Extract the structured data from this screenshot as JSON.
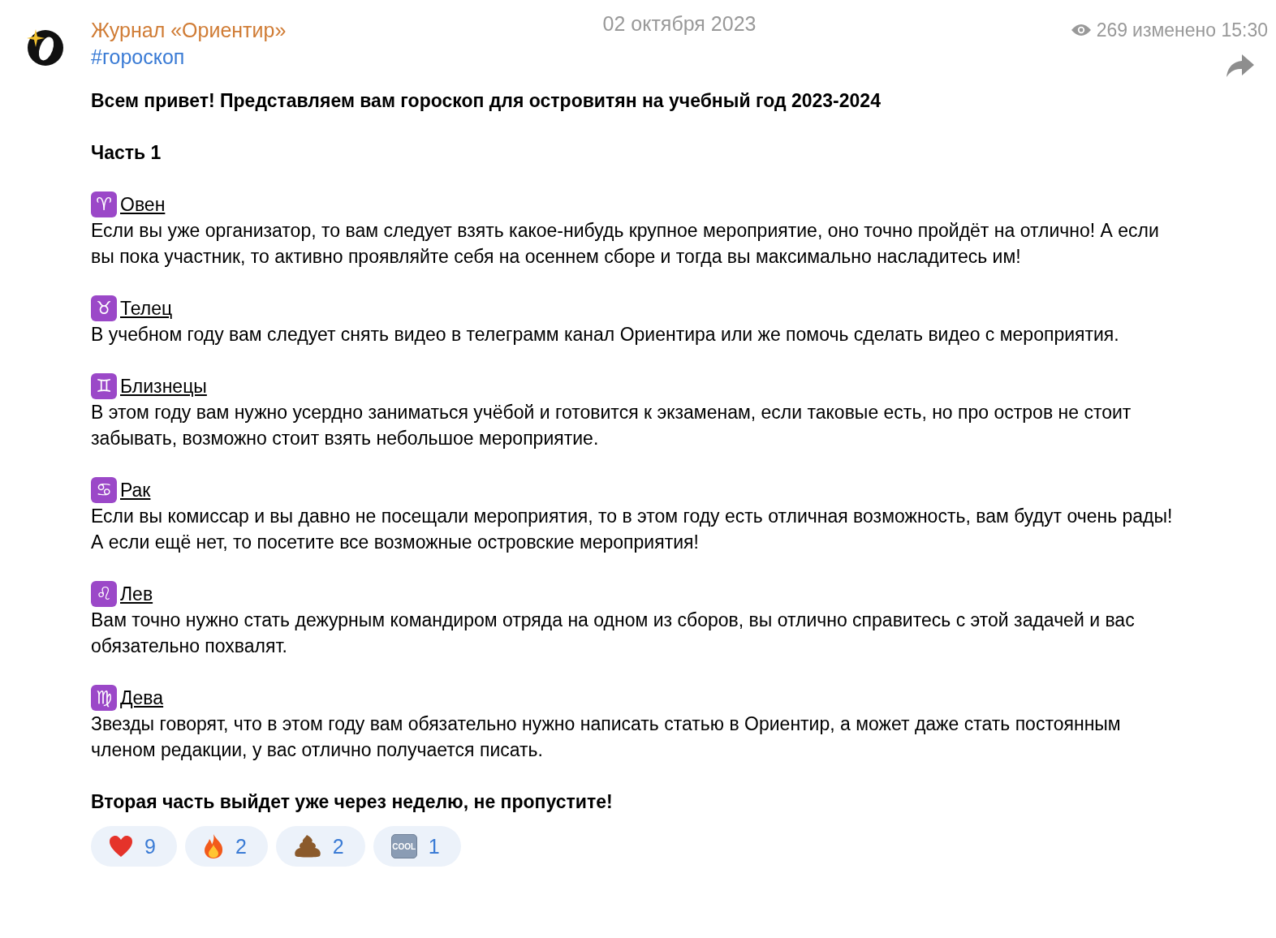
{
  "channel": {
    "name": "Журнал «Ориентир»",
    "hashtag": "#гороскоп"
  },
  "date": "02 октября 2023",
  "views": "269",
  "edited": "изменено 15:30",
  "post": {
    "intro": "Всем привет! Представляем вам гороскоп для островитян на учебный год 2023-2024",
    "part": "Часть 1",
    "signs": [
      {
        "symbol": "♈",
        "name": "Овен",
        "text": "Если вы уже организатор, то вам следует взять какое-нибудь крупное мероприятие, оно точно пройдёт на отлично! А если вы пока участник, то активно проявляйте себя на осеннем сборе и тогда вы максимально насладитесь им!"
      },
      {
        "symbol": "♉",
        "name": "Телец",
        "text": "В учебном году вам следует снять видео в телеграмм канал Ориентира или же помочь сделать видео с мероприятия."
      },
      {
        "symbol": "♊",
        "name": "Близнецы",
        "text": "В этом году вам нужно усердно заниматься учёбой и готовится к экзаменам, если таковые есть, но про остров не стоит забывать, возможно стоит взять небольшое мероприятие."
      },
      {
        "symbol": "♋",
        "name": "Рак",
        "text": "Если вы комиссар и вы давно не посещали мероприятия, то в этом году есть отличная возможность, вам будут очень рады! А если ещё нет, то посетите все возможные островские мероприятия!"
      },
      {
        "symbol": "♌",
        "name": "Лев",
        "text": "Вам точно нужно стать дежурным командиром отряда на одном из сборов, вы отлично справитесь с этой задачей и вас обязательно похвалят."
      },
      {
        "symbol": "♍",
        "name": "Дева",
        "text": "Звезды говорят, что в этом году вам обязательно нужно написать статью в Ориентир, а может даже стать постоянным членом редакции, у вас отлично получается писать."
      }
    ],
    "outro": "Вторая часть выйдет уже через неделю, не пропустите!"
  },
  "reactions": [
    {
      "kind": "heart",
      "count": "9"
    },
    {
      "kind": "fire",
      "count": "2"
    },
    {
      "kind": "poop",
      "count": "2"
    },
    {
      "kind": "badge",
      "label": "COOL",
      "count": "1"
    }
  ]
}
